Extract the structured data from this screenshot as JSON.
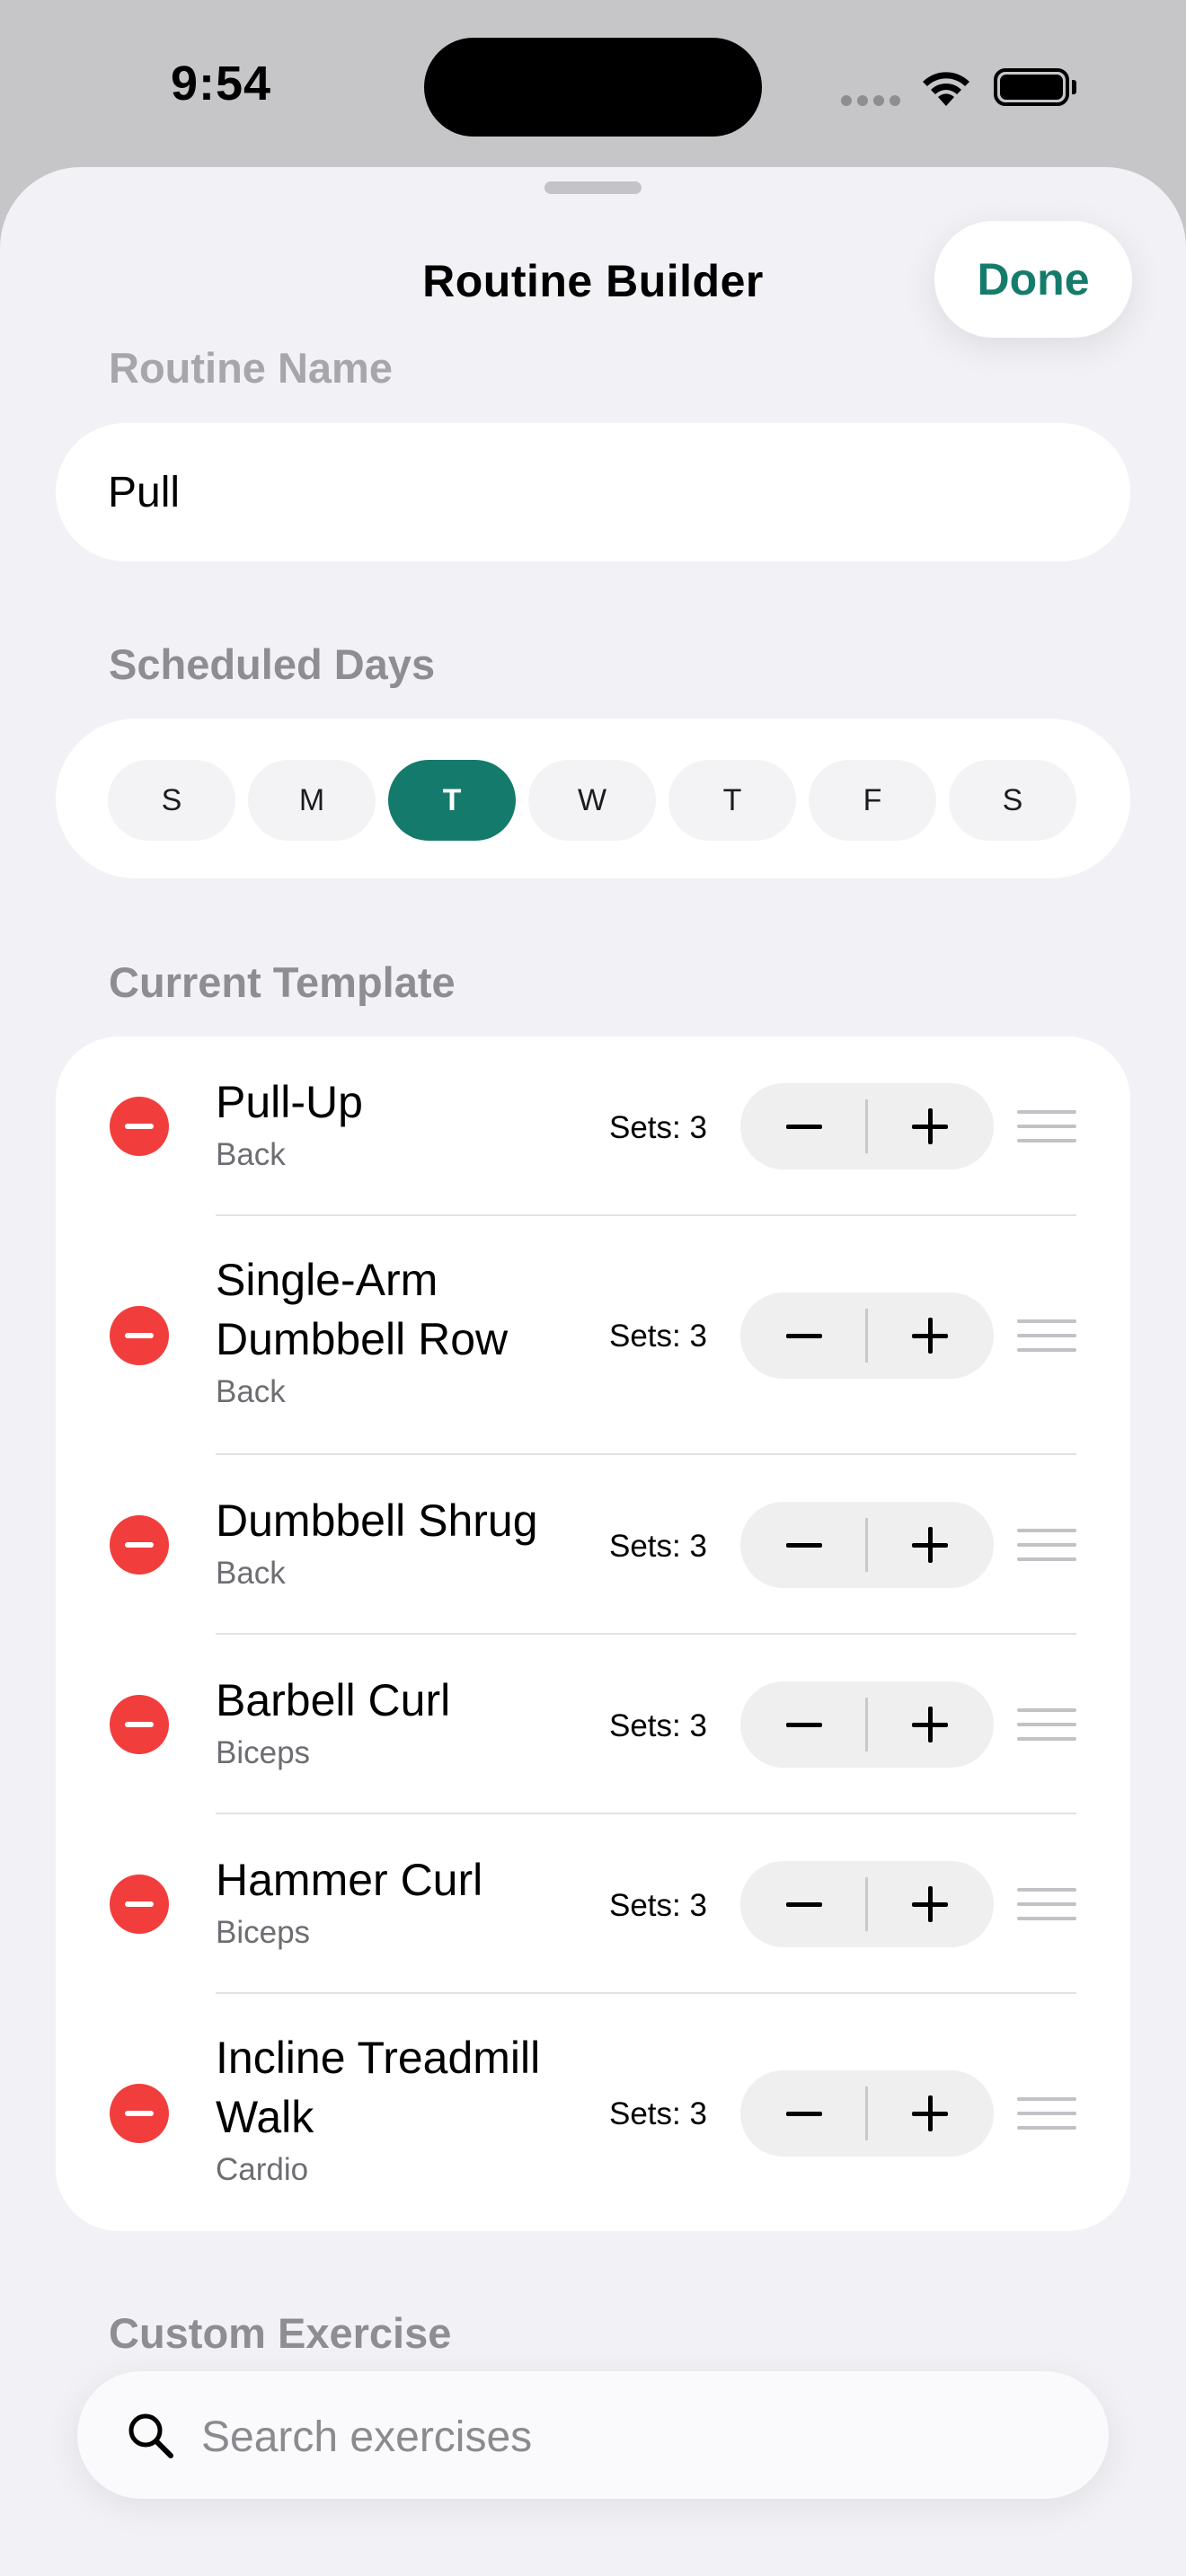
{
  "status_bar": {
    "time": "9:54"
  },
  "nav": {
    "title": "Routine Builder",
    "done_label": "Done"
  },
  "routine_name": {
    "label": "Routine Name",
    "value": "Pull"
  },
  "scheduled_days": {
    "label": "Scheduled Days",
    "days": [
      {
        "label": "S",
        "selected": false
      },
      {
        "label": "M",
        "selected": false
      },
      {
        "label": "T",
        "selected": true
      },
      {
        "label": "W",
        "selected": false
      },
      {
        "label": "T",
        "selected": false
      },
      {
        "label": "F",
        "selected": false
      },
      {
        "label": "S",
        "selected": false
      }
    ],
    "accent_color": "#147b6c"
  },
  "template": {
    "label": "Current Template",
    "exercises": [
      {
        "name_lines": [
          "Pull-Up"
        ],
        "category": "Back",
        "sets": "Sets: 3"
      },
      {
        "name_lines": [
          "Single-Arm",
          "Dumbbell Row"
        ],
        "category": "Back",
        "sets": "Sets: 3"
      },
      {
        "name_lines": [
          "Dumbbell Shrug"
        ],
        "category": "Back",
        "sets": "Sets: 3"
      },
      {
        "name_lines": [
          "Barbell Curl"
        ],
        "category": "Biceps",
        "sets": "Sets: 3"
      },
      {
        "name_lines": [
          "Hammer Curl"
        ],
        "category": "Biceps",
        "sets": "Sets: 3"
      },
      {
        "name_lines": [
          "Incline Treadmill",
          "Walk"
        ],
        "category": "Cardio",
        "sets": "Sets: 3"
      }
    ],
    "remove_color": "#f23d3d"
  },
  "custom_exercise": {
    "label": "Custom Exercise"
  },
  "search": {
    "placeholder": "Search exercises"
  }
}
